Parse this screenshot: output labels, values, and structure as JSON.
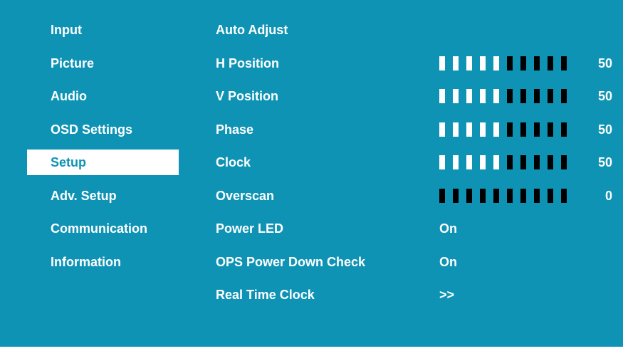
{
  "menu": {
    "items": [
      {
        "label": "Input"
      },
      {
        "label": "Picture"
      },
      {
        "label": "Audio"
      },
      {
        "label": "OSD Settings"
      },
      {
        "label": "Setup",
        "selected": true
      },
      {
        "label": "Adv. Setup"
      },
      {
        "label": "Communication"
      },
      {
        "label": "Information"
      }
    ]
  },
  "options": {
    "auto_adjust": {
      "label": "Auto Adjust"
    },
    "h_position": {
      "label": "H Position",
      "value": "50",
      "level": 0.5
    },
    "v_position": {
      "label": "V Position",
      "value": "50",
      "level": 0.5
    },
    "phase": {
      "label": "Phase",
      "value": "50",
      "level": 0.5
    },
    "clock": {
      "label": "Clock",
      "value": "50",
      "level": 0.5
    },
    "overscan": {
      "label": "Overscan",
      "value": "0",
      "level": 0
    },
    "power_led": {
      "label": "Power LED",
      "value": "On"
    },
    "ops_power_down_check": {
      "label": "OPS Power Down Check",
      "value": "On"
    },
    "real_time_clock": {
      "label": "Real Time Clock",
      "value": ">>"
    }
  },
  "colors": {
    "background": "#0e93b5",
    "text": "#ffffff",
    "selected_bg": "#ffffff",
    "bar_on": "#ffffff",
    "bar_off": "#000000"
  }
}
